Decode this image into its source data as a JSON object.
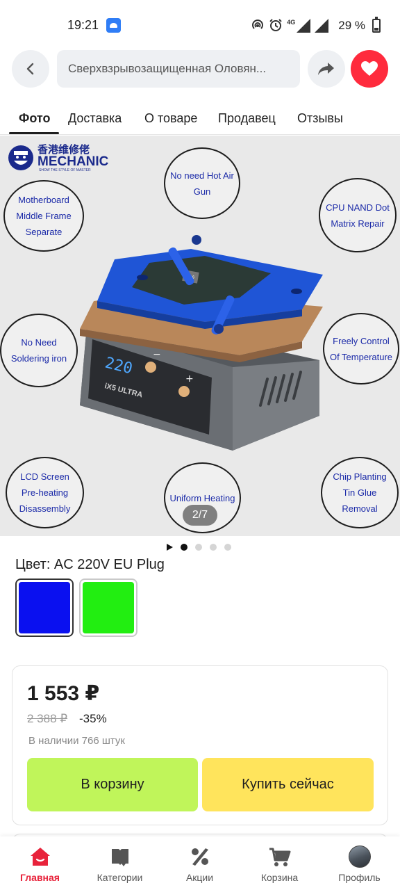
{
  "status_bar": {
    "time": "19:21",
    "battery": "29 %",
    "network": "4G",
    "icons": [
      "app-notification-icon",
      "hotspot-icon",
      "alarm-icon",
      "signal-icon",
      "signal-icon",
      "battery-icon"
    ]
  },
  "header": {
    "search_text": "Сверхвзрывозащищенная Оловян...",
    "back_icon": "chevron-left-icon",
    "share_icon": "share-arrow-icon",
    "favorite_icon": "heart-icon"
  },
  "tabs": [
    {
      "label": "Фото",
      "active": true
    },
    {
      "label": "Доставка",
      "active": false
    },
    {
      "label": "О товаре",
      "active": false
    },
    {
      "label": "Продавец",
      "active": false
    },
    {
      "label": "Отзывы",
      "active": false
    }
  ],
  "gallery": {
    "counter": "2/7",
    "brand": {
      "name": "MECHANIC",
      "tagline": "SHOW THE STYLE OF MASTER",
      "chinese": "香港维修佬"
    },
    "device": {
      "display": "220",
      "model": "iX5 ULTRA",
      "chip": "A16"
    },
    "features": [
      "No need Hot Air Gun",
      "Motherboard Middle Frame Separate",
      "CPU NAND Dot Matrix Repair",
      "No Need Soldering iron",
      "Freely Control Of Temperature",
      "LCD Screen Pre-heating Disassembly",
      "Uniform Heating",
      "Chip Planting Tin Glue Removal"
    ],
    "dot_count": 4,
    "active_dot": 0
  },
  "color": {
    "label": "Цвет: AC 220V EU Plug",
    "swatches": [
      {
        "color": "#0a10f0",
        "selected": true
      },
      {
        "color": "#22ee11",
        "selected": false
      }
    ]
  },
  "price": {
    "current": "1 553 ₽",
    "old": "2 388 ₽",
    "discount": "-35%",
    "stock": "В наличии 766 штук",
    "add_to_cart": "В корзину",
    "buy_now": "Купить сейчас"
  },
  "bottom_nav": [
    {
      "label": "Главная",
      "icon": "home-icon",
      "active": true
    },
    {
      "label": "Категории",
      "icon": "book-icon",
      "active": false
    },
    {
      "label": "Акции",
      "icon": "percent-icon",
      "active": false
    },
    {
      "label": "Корзина",
      "icon": "cart-icon",
      "active": false
    },
    {
      "label": "Профиль",
      "icon": "avatar-icon",
      "active": false
    }
  ],
  "colors": {
    "accent_red": "#ff2b3d",
    "cart_button": "#c0f55a",
    "buy_button": "#ffe45c",
    "active_nav": "#e8233b"
  }
}
